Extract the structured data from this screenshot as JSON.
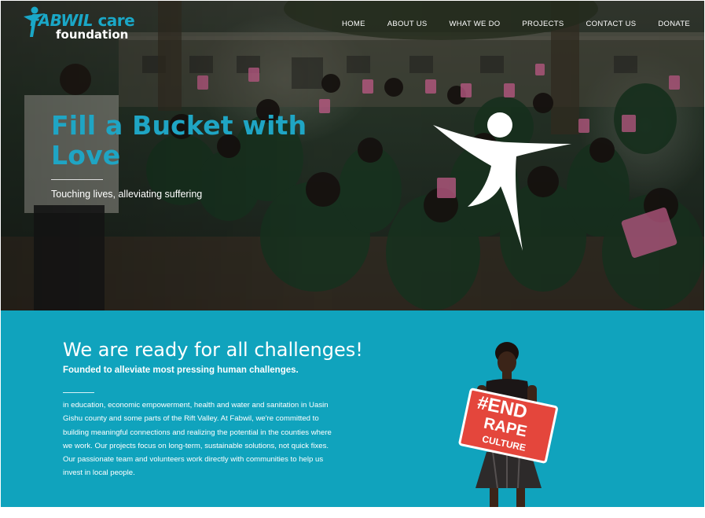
{
  "brand": {
    "logo_word": "FABWIL",
    "logo_care": "care",
    "logo_sub": "foundation",
    "accent_color": "#1aa7c7",
    "section_color": "#10a3bd"
  },
  "nav": {
    "items": [
      {
        "label": "HOME"
      },
      {
        "label": "ABOUT US"
      },
      {
        "label": "WHAT WE DO"
      },
      {
        "label": "PROJECTS"
      },
      {
        "label": "CONTACT US"
      },
      {
        "label": "DONATE"
      }
    ]
  },
  "hero": {
    "title": "Fill a Bucket with Love",
    "subtitle": "Touching lives, alleviating suffering",
    "figure_icon": "person-celebrating-icon"
  },
  "about": {
    "title": "We are ready for all challenges!",
    "subtitle": "Founded to alleviate most pressing human challenges.",
    "body_lines": [
      "in education, economic empowerment, health and water and sanitation in Uasin",
      "Gishu county and some parts of the Rift Valley. At Fabwil, we're committed to",
      "building meaningful connections and realizing the potential in the counties where",
      "we work. Our projects focus on long-term, sustainable solutions, not quick fixes.",
      "Our passionate team and volunteers work directly with communities to help us",
      "invest in local people."
    ],
    "sign": {
      "line1": "#END",
      "line2": "RAPE",
      "line3": "CULTURE"
    }
  }
}
